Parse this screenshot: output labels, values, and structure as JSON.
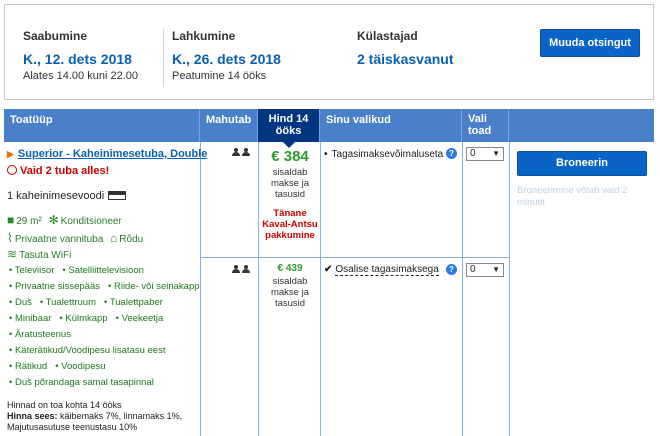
{
  "summary": {
    "checkin_label": "Saabumine",
    "checkin_date": "K., 12. dets 2018",
    "checkin_sub": "Alates 14.00 kuni 22.00",
    "checkout_label": "Lahkumine",
    "checkout_date": "K., 26. dets 2018",
    "checkout_sub": "Peatumine 14 ööks",
    "guests_label": "Külastajad",
    "guests_value": "2 täiskasvanut",
    "change_button": "Muuda otsingut"
  },
  "table": {
    "headers": {
      "room_type": "Toatüüp",
      "capacity": "Mahutab",
      "price_line1": "Hind 14",
      "price_line2": "ööks",
      "choices": "Sinu valikud",
      "rooms_line1": "Vali",
      "rooms_line2": "toad"
    },
    "room": {
      "title": "Superior - Kaheinimesetuba, Double",
      "rooms_left": "Vaid 2 tuba alles!",
      "bed": "1 kaheinimesevoodi",
      "facilities": [
        "29 m²",
        "Konditsioneer",
        "Privaatne vannituba",
        "Rõdu",
        "Tasuta WiFi"
      ],
      "amenities": [
        "Televiisor",
        "Satelliittelevisioon",
        "Privaatne sissepääs",
        "Riide- või seinakapp",
        "Duš",
        "Tualettruum",
        "Tualettpaber",
        "Minibaar",
        "Külmkapp",
        "Veekeetja",
        "Äratusteenus",
        "Käterätikud/Voodipesu lisatasu eest",
        "Rätikud",
        "Voodipesu",
        "Duš põrandaga samal tasapinnal"
      ],
      "tax_line1": "Hinnad on toa kohta 14 ööks",
      "tax_label": "Hinna sees:",
      "tax_text": "käibemaks 7%, linnamaks 1%, Majutusasutuse teenustasu 10%"
    },
    "options": [
      {
        "price": "€ 384",
        "note": "sisaldab makse ja tasusid",
        "deal": "Tänane Kaval-Antsu pakkumine",
        "choice": "Tagasimaksevõimaluseta",
        "rooms_selected": "0"
      },
      {
        "price": "€ 439",
        "note": "sisaldab makse ja tasusid",
        "choice": "Osalise tagasimaksega",
        "rooms_selected": "0"
      }
    ],
    "book_button": "Broneerin",
    "book_note": "Broneerimine võtab vaid 2 minutit"
  },
  "colors": {
    "header_blue": "#4a7fc9",
    "price_header": "#003580",
    "button_blue": "#0a63c7",
    "price_green": "#2d9a2d",
    "alert_red": "#cc0000",
    "link_blue": "#0a5fb0"
  }
}
